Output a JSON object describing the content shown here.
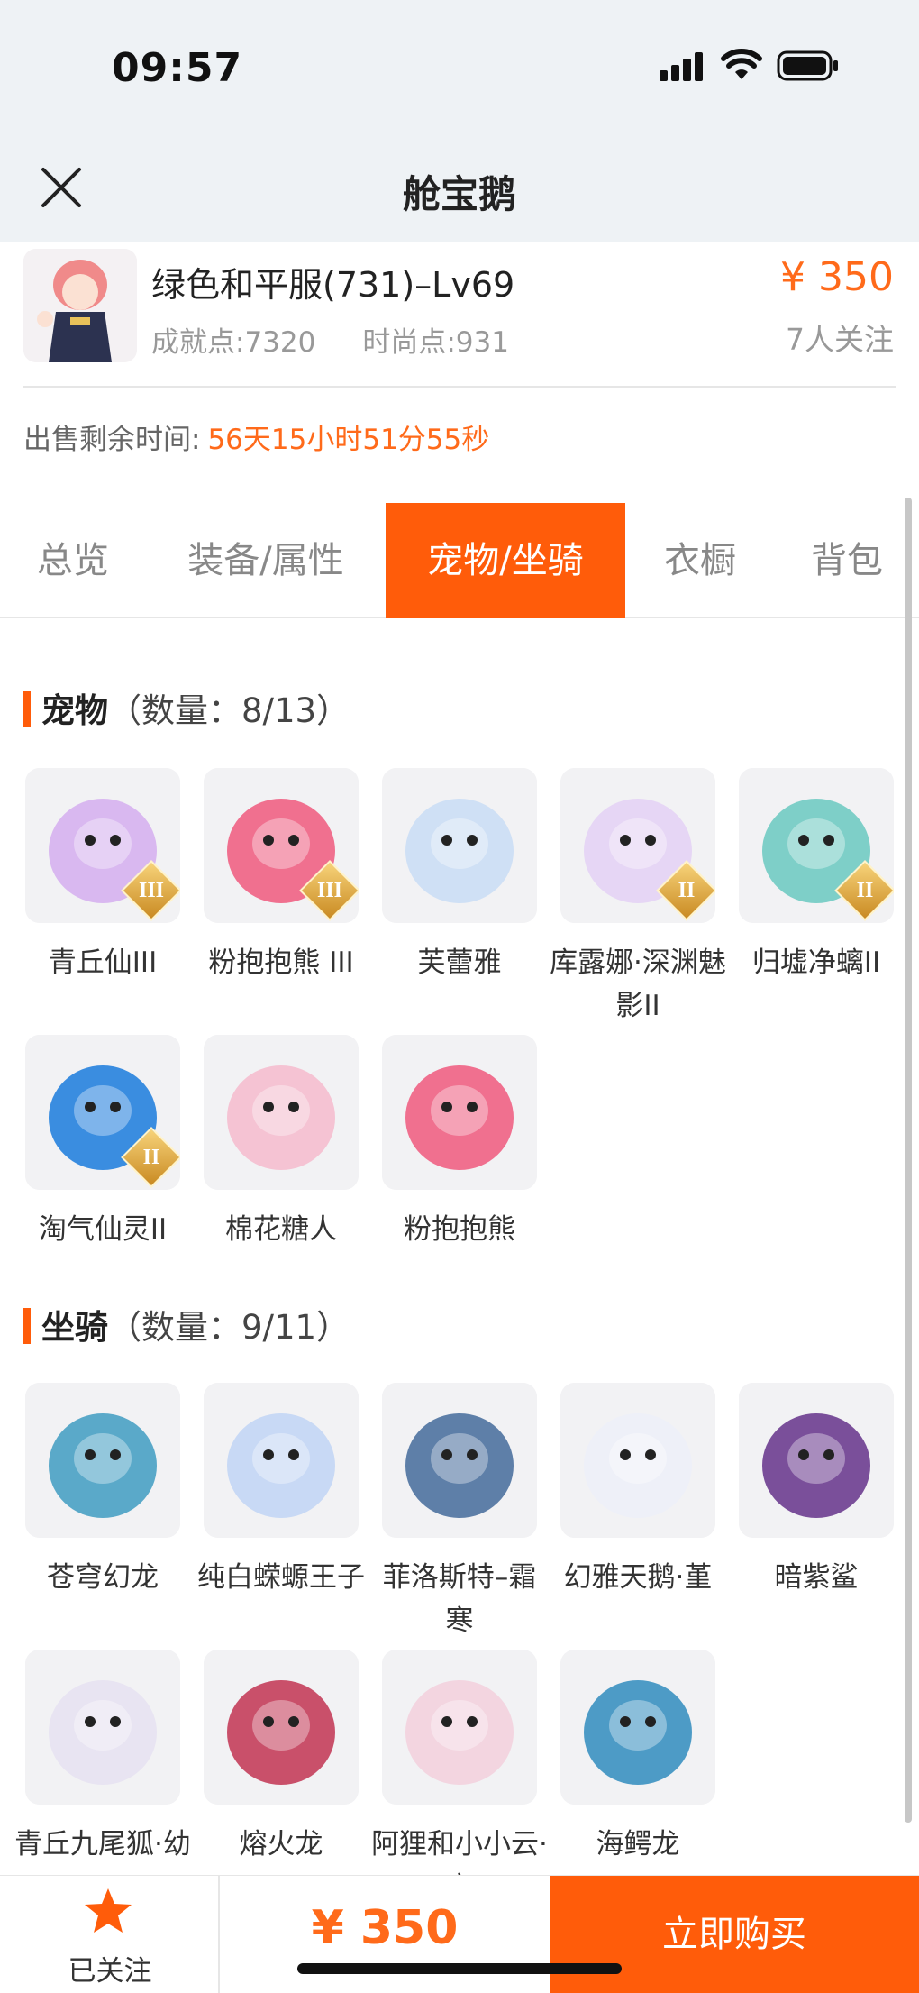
{
  "status": {
    "time": "09:57"
  },
  "nav": {
    "title": "舱宝鹅"
  },
  "listing": {
    "name": "绿色和平服(731)–Lv69",
    "achievement": "成就点:7320",
    "fashion": "时尚点:931",
    "price": "¥ 350",
    "followers": "7人关注",
    "remaining_label": "出售剩余时间:",
    "remaining_value": "56天15小时51分55秒"
  },
  "tabs": [
    "总览",
    "装备/属性",
    "宠物/坐骑",
    "衣橱",
    "背包"
  ],
  "active_tab": "宠物/坐骑",
  "pets": {
    "title": "宠物",
    "count": "（数量：8/13）",
    "items": [
      {
        "name": "青丘仙III",
        "grade": "III",
        "color": "#d9b8f0"
      },
      {
        "name": "粉抱抱熊 III",
        "grade": "III",
        "color": "#f0708f"
      },
      {
        "name": "芙蕾雅",
        "grade": "",
        "color": "#cfe0f5"
      },
      {
        "name": "库露娜·深渊魅影II",
        "grade": "II",
        "color": "#e6d6f5"
      },
      {
        "name": "归墟净螭II",
        "grade": "II",
        "color": "#7ecfc8"
      },
      {
        "name": "淘气仙灵II",
        "grade": "II",
        "color": "#3a8de0"
      },
      {
        "name": "棉花糖人",
        "grade": "",
        "color": "#f5c3d3"
      },
      {
        "name": "粉抱抱熊",
        "grade": "",
        "color": "#f0708f"
      }
    ]
  },
  "mounts": {
    "title": "坐骑",
    "count": "（数量：9/11）",
    "items": [
      {
        "name": "苍穹幻龙",
        "color": "#5aa9c9"
      },
      {
        "name": "纯白蝾螈王子",
        "color": "#c8d9f5"
      },
      {
        "name": "菲洛斯特–霜寒",
        "color": "#5e7fa8"
      },
      {
        "name": "幻雅天鹅·堇",
        "color": "#eef0f8"
      },
      {
        "name": "暗紫鲨",
        "color": "#7a4f9a"
      },
      {
        "name": "青丘九尾狐·幼",
        "color": "#e8e4f2"
      },
      {
        "name": "熔火龙",
        "color": "#c9506a"
      },
      {
        "name": "阿狸和小小云·高",
        "color": "#f3d5e0"
      },
      {
        "name": "海鳄龙",
        "color": "#4d9bc6"
      }
    ]
  },
  "bottom": {
    "follow_label": "已关注",
    "price": "¥ 350",
    "buy_label": "立即购买"
  },
  "colors": {
    "accent": "#ff5c0a",
    "price": "#ff6a1a"
  },
  "icons": [
    "close-icon",
    "signal-icon",
    "wifi-icon",
    "battery-icon",
    "star-icon"
  ]
}
